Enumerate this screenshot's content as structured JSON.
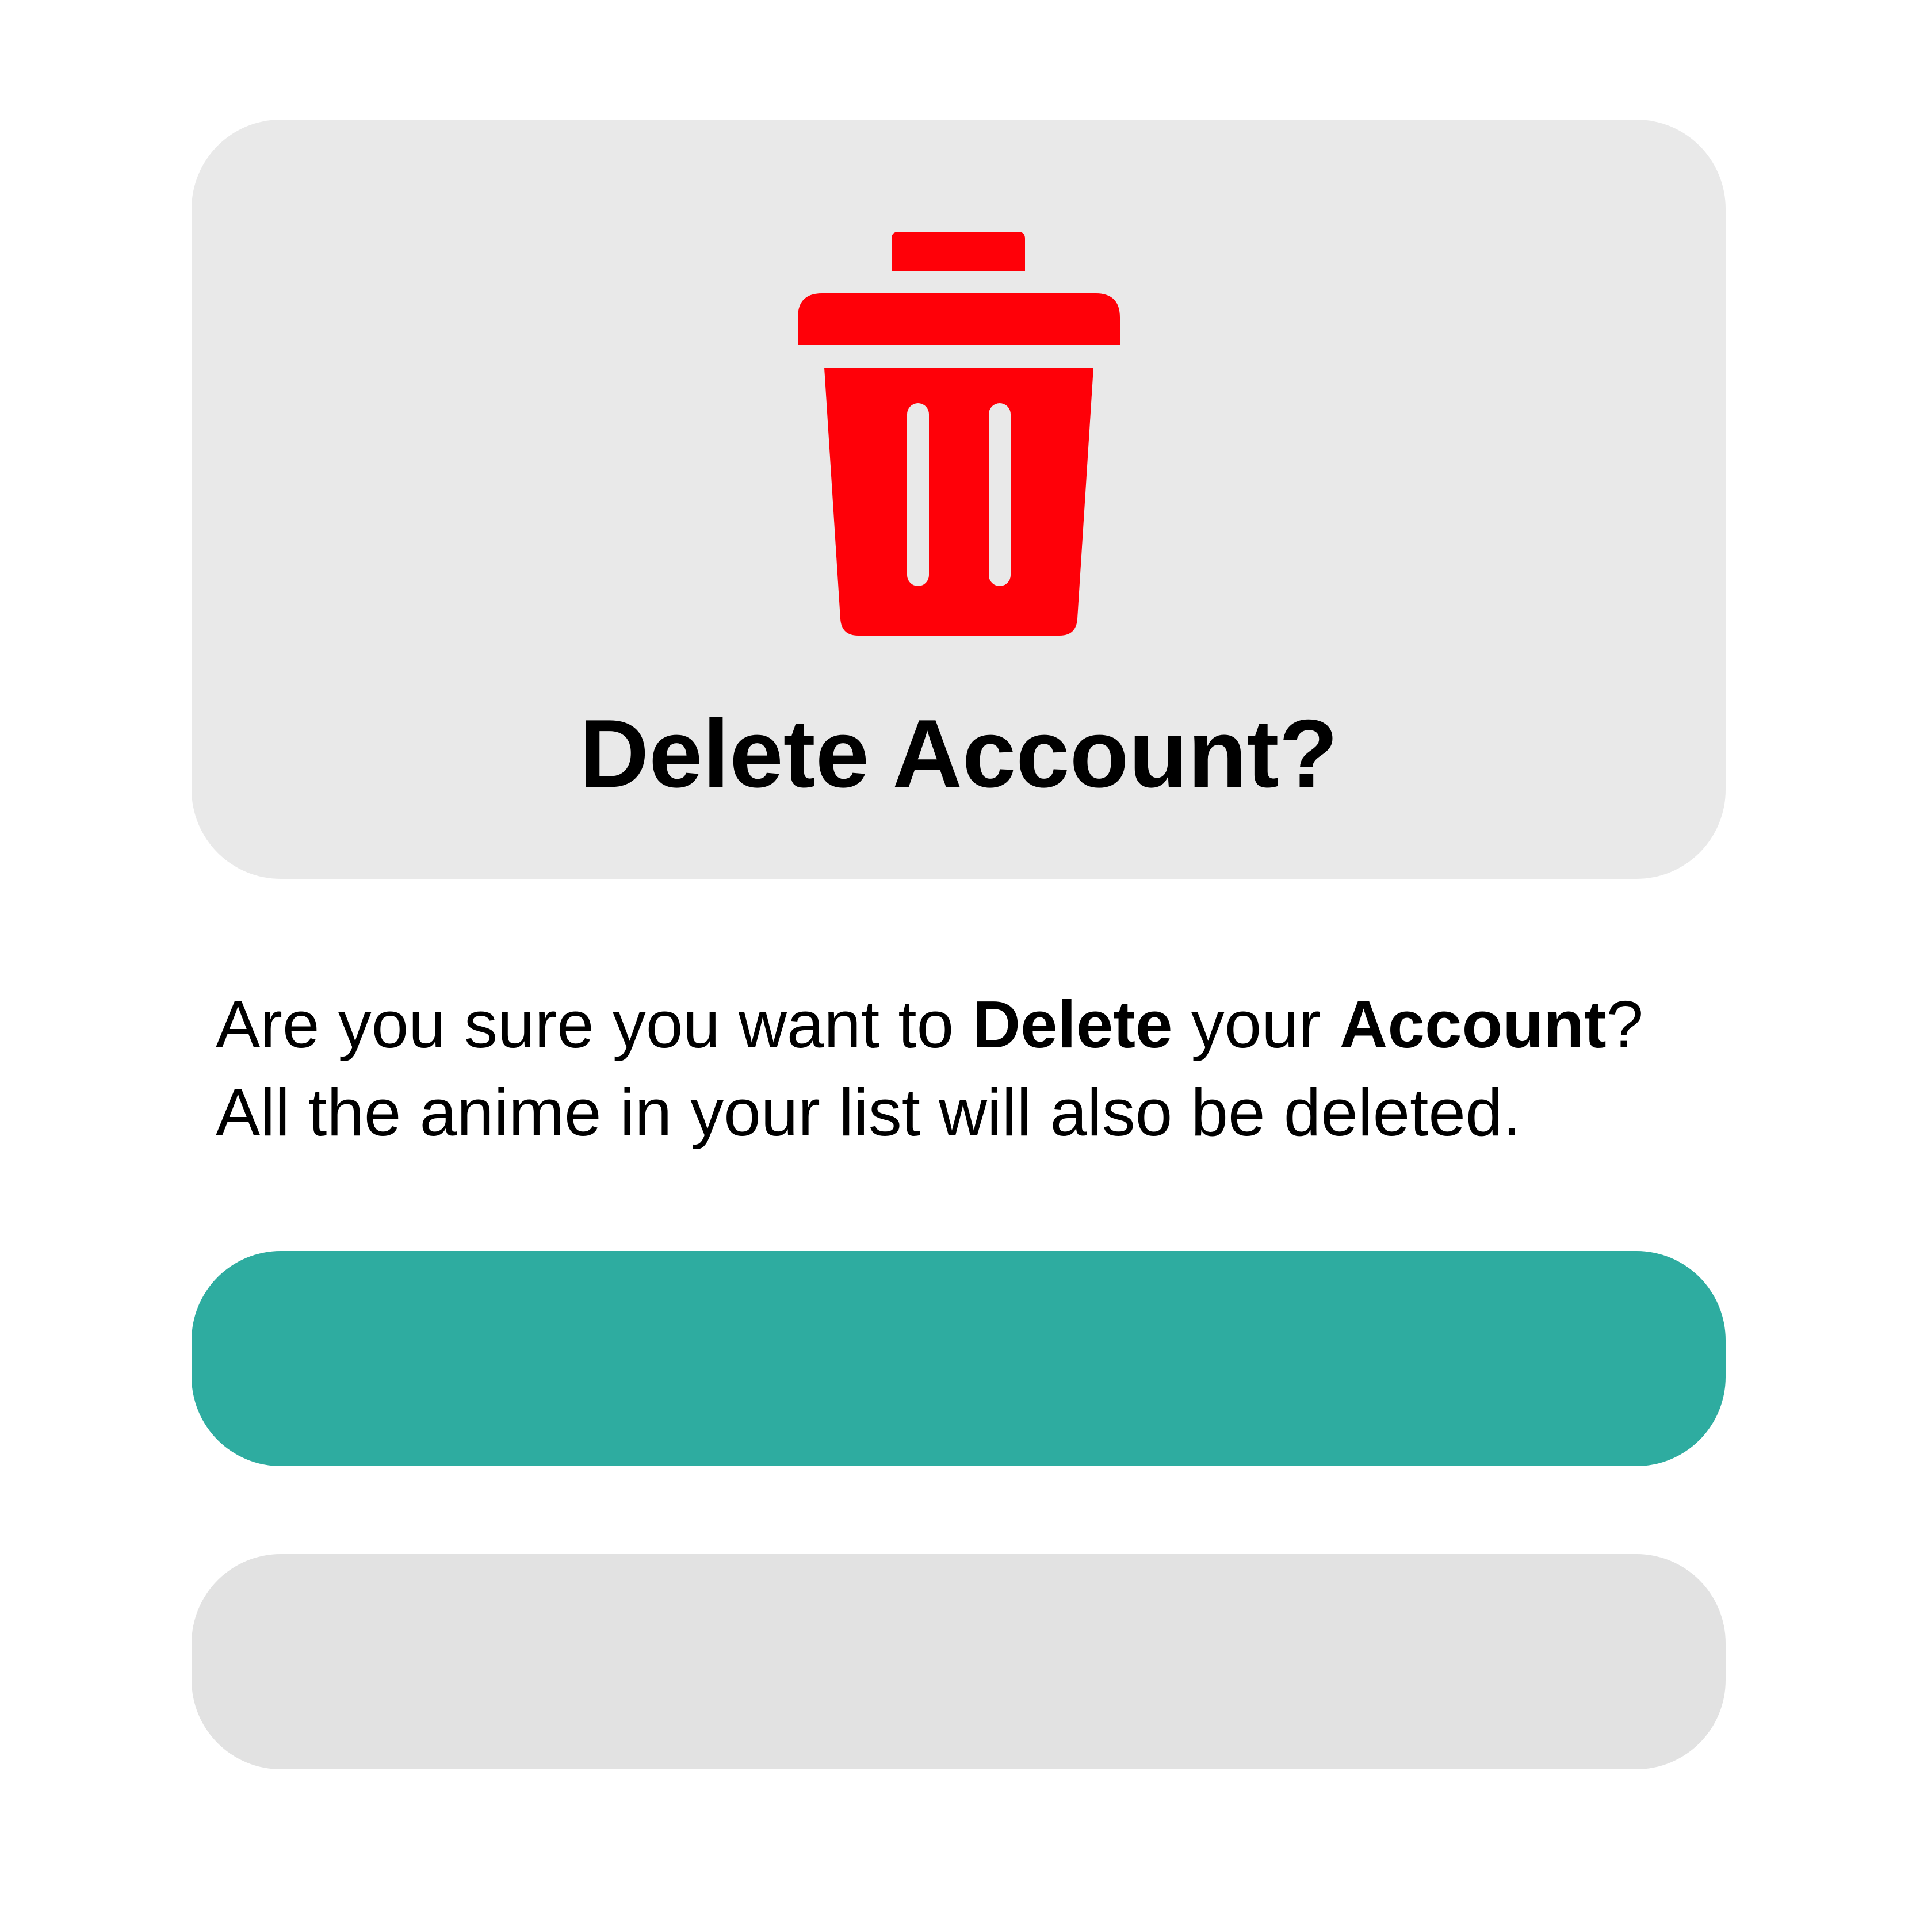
{
  "dialog": {
    "icon": "trash-icon",
    "title": "Delete Account?",
    "message": {
      "line1_part1": "Are you sure you want to ",
      "line1_bold1": "Delete",
      "line1_part2": " your ",
      "line1_bold2": "Account",
      "line1_part3": "?",
      "line2": "All the anime in your list will also be deleted."
    },
    "confirm_button": {
      "label": ""
    },
    "cancel_button": {
      "label": ""
    }
  },
  "colors": {
    "background": "#ffffff",
    "header_card": "#e9e9e9",
    "icon": "#ff0008",
    "confirm_button": "#2eaca0",
    "cancel_button": "#e2e2e2",
    "text": "#000000"
  }
}
